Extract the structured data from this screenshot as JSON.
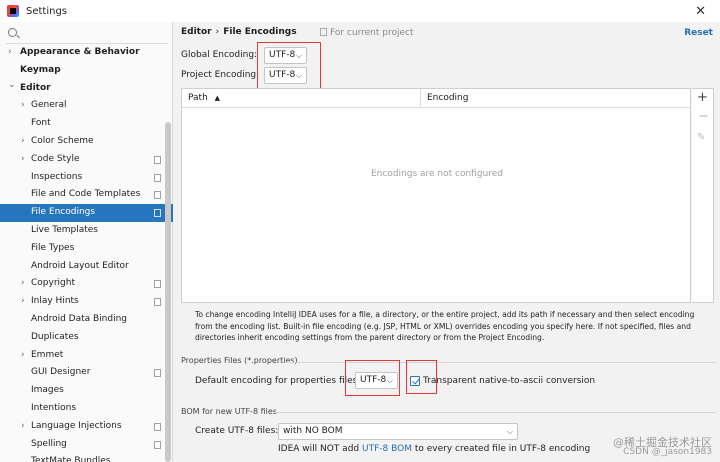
{
  "window": {
    "title": "Settings",
    "close_icon": "close-icon"
  },
  "sidebar": {
    "items": [
      {
        "label": "Appearance & Behavior",
        "bold": true,
        "arrow": "right",
        "level": 0,
        "project": false
      },
      {
        "label": "Keymap",
        "bold": true,
        "arrow": "",
        "level": 0,
        "project": false
      },
      {
        "label": "Editor",
        "bold": true,
        "arrow": "down",
        "level": 0,
        "project": false
      },
      {
        "label": "General",
        "arrow": "right",
        "level": 1,
        "project": false
      },
      {
        "label": "Font",
        "arrow": "",
        "level": 1,
        "project": false
      },
      {
        "label": "Color Scheme",
        "arrow": "right",
        "level": 1,
        "project": false
      },
      {
        "label": "Code Style",
        "arrow": "right",
        "level": 1,
        "project": true
      },
      {
        "label": "Inspections",
        "arrow": "",
        "level": 1,
        "project": true
      },
      {
        "label": "File and Code Templates",
        "arrow": "",
        "level": 1,
        "project": true
      },
      {
        "label": "File Encodings",
        "arrow": "",
        "level": 1,
        "project": true,
        "selected": true
      },
      {
        "label": "Live Templates",
        "arrow": "",
        "level": 1,
        "project": false
      },
      {
        "label": "File Types",
        "arrow": "",
        "level": 1,
        "project": false
      },
      {
        "label": "Android Layout Editor",
        "arrow": "",
        "level": 1,
        "project": false
      },
      {
        "label": "Copyright",
        "arrow": "right",
        "level": 1,
        "project": true
      },
      {
        "label": "Inlay Hints",
        "arrow": "right",
        "level": 1,
        "project": true
      },
      {
        "label": "Android Data Binding",
        "arrow": "",
        "level": 1,
        "project": false
      },
      {
        "label": "Duplicates",
        "arrow": "",
        "level": 1,
        "project": false
      },
      {
        "label": "Emmet",
        "arrow": "right",
        "level": 1,
        "project": false
      },
      {
        "label": "GUI Designer",
        "arrow": "",
        "level": 1,
        "project": true
      },
      {
        "label": "Images",
        "arrow": "",
        "level": 1,
        "project": false
      },
      {
        "label": "Intentions",
        "arrow": "",
        "level": 1,
        "project": false
      },
      {
        "label": "Language Injections",
        "arrow": "right",
        "level": 1,
        "project": true
      },
      {
        "label": "Spelling",
        "arrow": "",
        "level": 1,
        "project": true
      },
      {
        "label": "TextMate Bundles",
        "arrow": "",
        "level": 1,
        "project": false
      }
    ]
  },
  "header": {
    "breadcrumb_parent": "Editor",
    "breadcrumb_sep": "›",
    "breadcrumb_current": "File Encodings",
    "scope_text": "For current project",
    "reset_label": "Reset"
  },
  "encodings": {
    "global_label": "Global Encoding:",
    "global_value": "UTF-8",
    "project_label": "Project Encoding:",
    "project_value": "UTF-8"
  },
  "table": {
    "col_path": "Path",
    "col_path_sort": "▲",
    "col_encoding": "Encoding",
    "empty_text": "Encodings are not configured",
    "add_icon": "+",
    "remove_icon": "−",
    "edit_icon": "✎"
  },
  "info_text": "To change encoding IntelliJ IDEA uses for a file, a directory, or the entire project, add its path if necessary and then select encoding from the encoding list. Built-in file encoding (e.g. JSP, HTML or XML) overrides encoding you specify here. If not specified, files and directories inherit encoding settings from the parent directory or from the Project Encoding.",
  "properties": {
    "section_title": "Properties Files (*.properties)",
    "default_label": "Default encoding for properties files:",
    "default_value": "UTF-8",
    "transparent_label": "Transparent native-to-ascii conversion",
    "transparent_checked": true
  },
  "bom": {
    "section_title": "BOM for new UTF-8 files",
    "create_label": "Create UTF-8 files:",
    "create_value": "with NO BOM",
    "note_prefix": "IDEA will NOT add ",
    "note_link": "UTF-8 BOM",
    "note_suffix": " to every created file in UTF-8 encoding"
  },
  "watermark": {
    "line1": "@稀土掘金技术社区",
    "line2": "CSDN @_jason1983"
  },
  "colors": {
    "selection": "#2675bf",
    "link": "#2470b3",
    "highlight_box": "#e53935"
  }
}
